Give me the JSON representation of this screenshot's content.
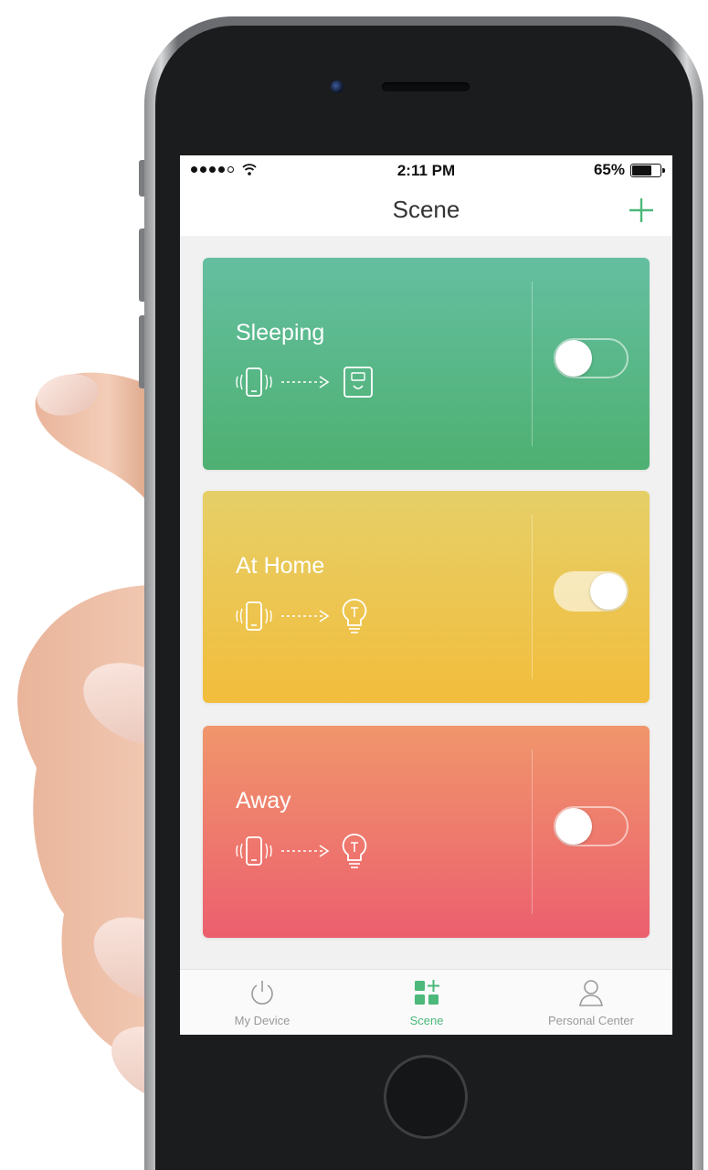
{
  "status_bar": {
    "signal_icon": "signal-dots",
    "wifi_icon": "wifi-icon",
    "time": "2:11 PM",
    "battery_percent": "65%",
    "battery_level": 0.65
  },
  "nav": {
    "title": "Scene",
    "add_icon": "plus-icon",
    "accent_color": "#4cb87a"
  },
  "scenes": [
    {
      "title": "Sleeping",
      "enabled": false,
      "trigger_icon": "phone-vibrate-icon",
      "arrow_icon": "dashed-arrow-icon",
      "action_icon": "smart-plug-icon",
      "gradient": [
        "#64bfa0",
        "#4eb071"
      ]
    },
    {
      "title": "At Home",
      "enabled": true,
      "trigger_icon": "phone-vibrate-icon",
      "arrow_icon": "dashed-arrow-icon",
      "action_icon": "light-bulb-icon",
      "gradient": [
        "#e6cf68",
        "#f2bd3c"
      ]
    },
    {
      "title": "Away",
      "enabled": false,
      "trigger_icon": "phone-vibrate-icon",
      "arrow_icon": "dashed-arrow-icon",
      "action_icon": "light-bulb-icon",
      "gradient": [
        "#f0966c",
        "#ec5f6e"
      ]
    }
  ],
  "tabs": [
    {
      "label": "My Device",
      "icon": "power-icon",
      "active": false
    },
    {
      "label": "Scene",
      "icon": "scene-grid-icon",
      "active": true
    },
    {
      "label": "Personal Center",
      "icon": "person-icon",
      "active": false
    }
  ]
}
